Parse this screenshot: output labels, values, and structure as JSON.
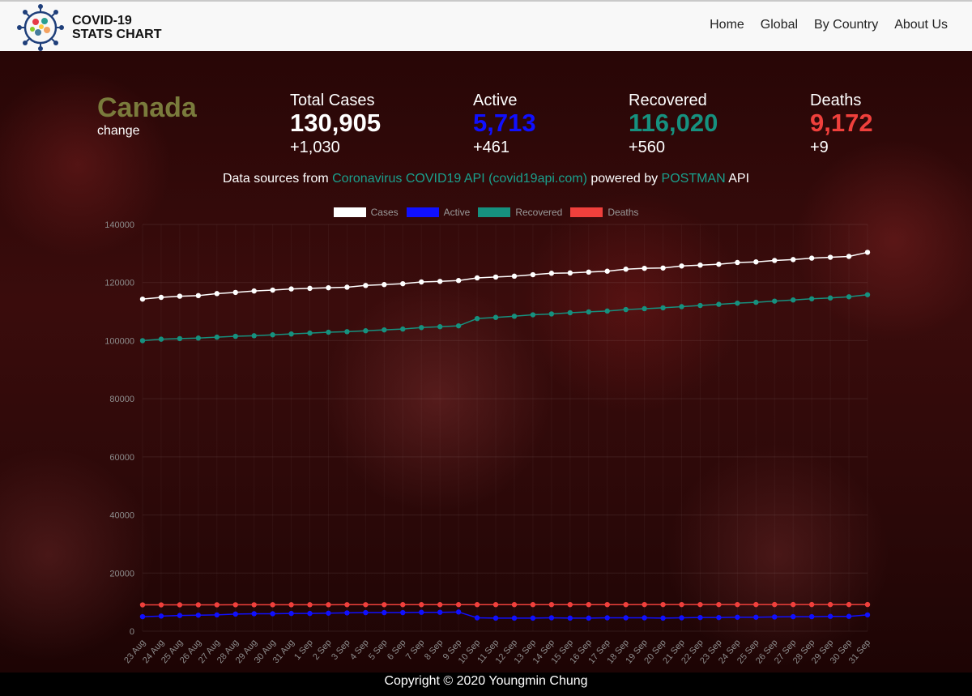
{
  "navbar": {
    "title_line1": "COVID-19",
    "title_line2": "STATS CHART",
    "links": [
      "Home",
      "Global",
      "By Country",
      "About Us"
    ]
  },
  "country": {
    "name": "Canada",
    "change_label": "change"
  },
  "stats": [
    {
      "label": "Total Cases",
      "value": "130,905",
      "change": "+1,030",
      "color": "#ffffff"
    },
    {
      "label": "Active",
      "value": "5,713",
      "change": "+461",
      "color": "#1010ff"
    },
    {
      "label": "Recovered",
      "value": "116,020",
      "change": "+560",
      "color": "#16917f"
    },
    {
      "label": "Deaths",
      "value": "9,172",
      "change": "+9",
      "color": "#f0403c"
    }
  ],
  "source": {
    "prefix": "Data sources from ",
    "api_link": "Coronavirus COVID19 API (covid19api.com)",
    "middle": " powered by ",
    "postman_link": "POSTMAN",
    "suffix": " API"
  },
  "chart_data": {
    "type": "line",
    "x": [
      "23 Aug",
      "24 Aug",
      "25 Aug",
      "26 Aug",
      "27 Aug",
      "28 Aug",
      "29 Aug",
      "30 Aug",
      "31 Aug",
      "1 Sep",
      "2 Sep",
      "3 Sep",
      "4 Sep",
      "5 Sep",
      "6 Sep",
      "7 Sep",
      "8 Sep",
      "9 Sep",
      "10 Sep",
      "11 Sep",
      "12 Sep",
      "13 Sep",
      "14 Sep",
      "15 Sep",
      "16 Sep",
      "17 Sep",
      "18 Sep",
      "19 Sep",
      "20 Sep",
      "21 Sep",
      "22 Sep",
      "23 Sep",
      "24 Sep",
      "25 Sep",
      "26 Sep",
      "27 Sep",
      "28 Sep",
      "29 Sep",
      "30 Sep",
      "31 Sep"
    ],
    "series": [
      {
        "name": "Cases",
        "color": "#ffffff",
        "values": [
          114300,
          114900,
          115300,
          115500,
          116200,
          116600,
          117100,
          117400,
          117800,
          118000,
          118200,
          118400,
          119000,
          119300,
          119600,
          120200,
          120400,
          120700,
          121600,
          121900,
          122200,
          122700,
          123200,
          123300,
          123600,
          123900,
          124600,
          124900,
          125000,
          125700,
          126000,
          126300,
          126900,
          127100,
          127600,
          127900,
          128400,
          128700,
          129000,
          130400
        ]
      },
      {
        "name": "Active",
        "color": "#1010ff",
        "values": [
          5000,
          5200,
          5400,
          5500,
          5600,
          5900,
          6000,
          6000,
          6100,
          6100,
          6200,
          6300,
          6400,
          6400,
          6400,
          6500,
          6500,
          6600,
          4600,
          4500,
          4500,
          4500,
          4600,
          4500,
          4500,
          4600,
          4600,
          4600,
          4500,
          4600,
          4700,
          4700,
          4800,
          4800,
          4900,
          5000,
          5000,
          5100,
          5100,
          5600
        ]
      },
      {
        "name": "Recovered",
        "color": "#16917f",
        "values": [
          100000,
          100500,
          100700,
          100900,
          101200,
          101500,
          101700,
          102000,
          102300,
          102600,
          102900,
          103100,
          103400,
          103700,
          104000,
          104500,
          104800,
          105100,
          107600,
          108000,
          108400,
          108900,
          109200,
          109600,
          109900,
          110200,
          110700,
          111000,
          111300,
          111700,
          112100,
          112500,
          112900,
          113200,
          113600,
          114000,
          114400,
          114700,
          115100,
          115800
        ]
      },
      {
        "name": "Deaths",
        "color": "#f0403c",
        "values": [
          9050,
          9060,
          9070,
          9070,
          9080,
          9090,
          9090,
          9100,
          9100,
          9110,
          9110,
          9120,
          9120,
          9120,
          9130,
          9130,
          9130,
          9140,
          9140,
          9140,
          9140,
          9140,
          9150,
          9150,
          9150,
          9150,
          9150,
          9160,
          9160,
          9160,
          9160,
          9160,
          9160,
          9170,
          9170,
          9170,
          9170,
          9170,
          9170,
          9172
        ]
      }
    ],
    "yticks": [
      0,
      20000,
      40000,
      60000,
      80000,
      100000,
      120000,
      140000
    ],
    "ylim": [
      0,
      140000
    ],
    "legend_position": "top-center",
    "grid": true
  },
  "footer": {
    "text": "Copyright © 2020 Youngmin Chung"
  }
}
